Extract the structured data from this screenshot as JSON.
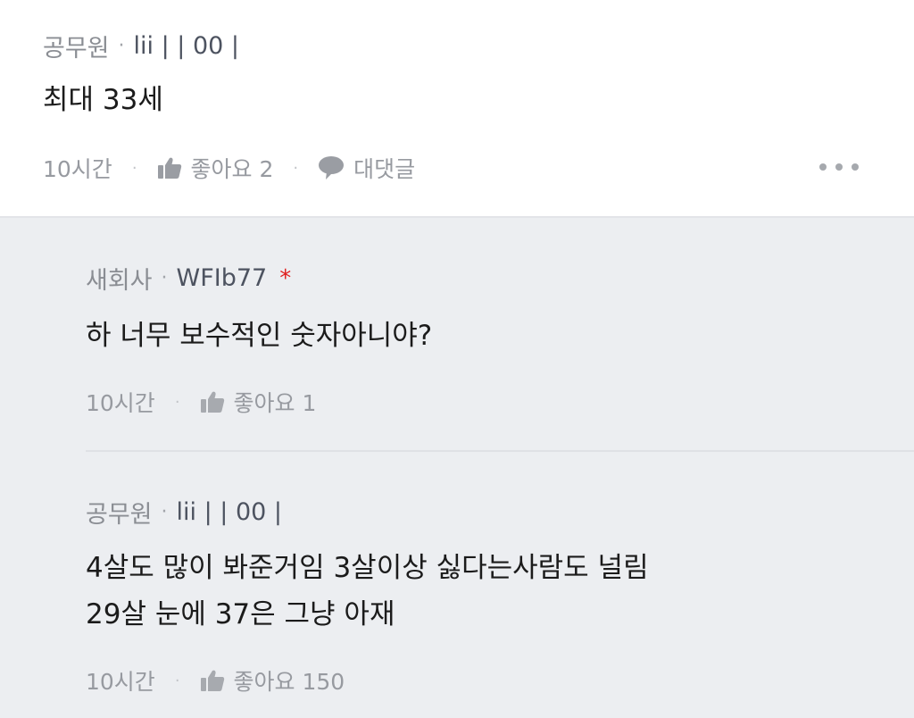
{
  "comment": {
    "author_job": "공무원",
    "author_nick": "lii |  | 00 |",
    "text": "최대 33세",
    "time": "10시간",
    "like_label": "좋아요 2",
    "reply_label": "대댓글"
  },
  "replies": [
    {
      "author_job": "새회사",
      "author_nick": "WFIb77",
      "author_badge": "*",
      "lines": [
        "하 너무 보수적인 숫자아니야?"
      ],
      "time": "10시간",
      "like_label": "좋아요 1"
    },
    {
      "author_job": "공무원",
      "author_nick": "lii |  | 00 |",
      "lines": [
        "4살도 많이 봐준거임 3살이상 싫다는사람도 널림",
        "29살 눈에 37은 그냥 아재"
      ],
      "time": "10시간",
      "like_label": "좋아요 150"
    }
  ],
  "separator": "·",
  "colors": {
    "reply_background": "#eceef1",
    "badge_red": "#e02020",
    "meta_gray": "#8a8d93"
  }
}
